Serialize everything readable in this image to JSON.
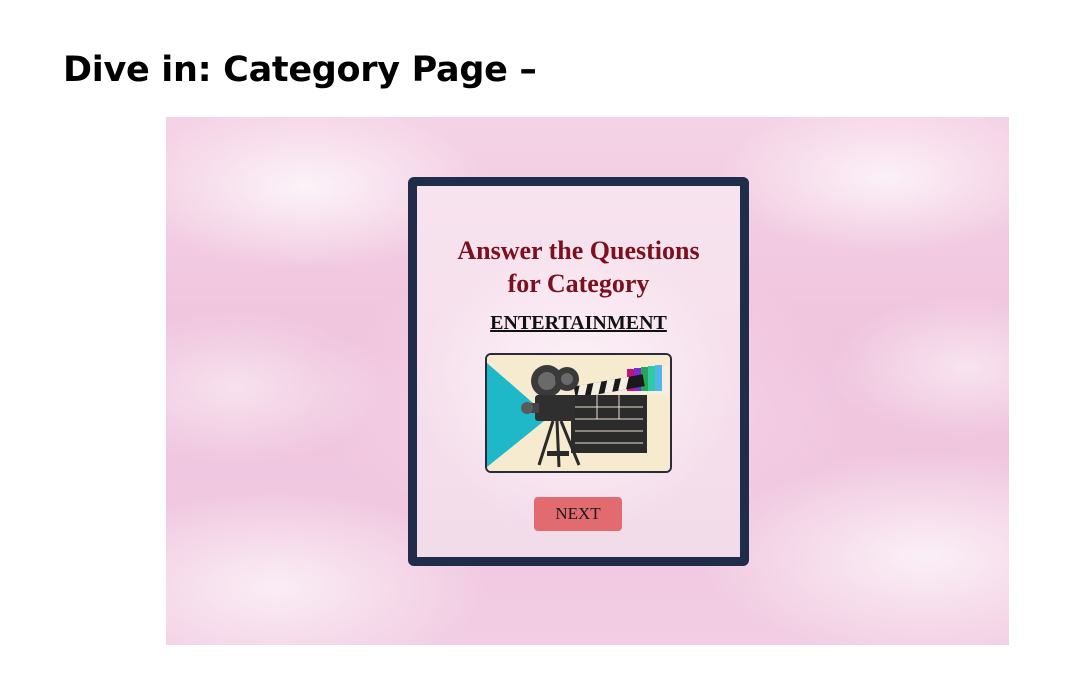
{
  "slide": {
    "title": "Dive in: Category Page –"
  },
  "category_page": {
    "heading_line1": "Answer the Questions",
    "heading_line2": "for Category",
    "category_name": "ENTERTAINMENT",
    "image_icon": "movie-camera-clapperboard-icon",
    "next_label": "NEXT"
  },
  "colors": {
    "card_border": "#1f2d4a",
    "heading": "#7a1020",
    "next_button": "#e26b70",
    "background": "#efc3dd"
  }
}
